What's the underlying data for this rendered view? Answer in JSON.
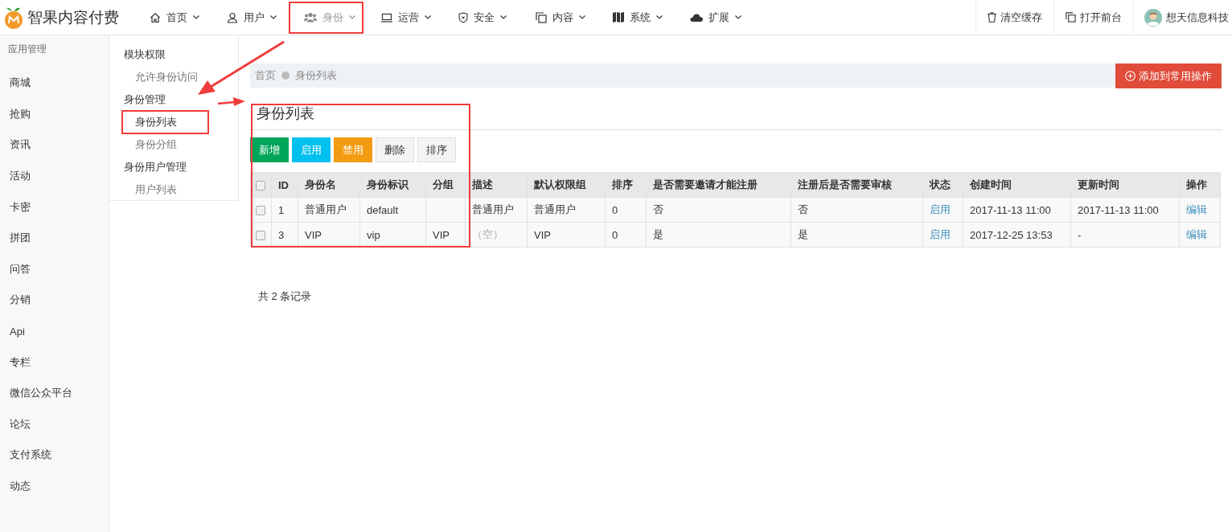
{
  "brand": {
    "title": "智果内容付费"
  },
  "nav": [
    {
      "label": "首页",
      "selected": false
    },
    {
      "label": "用户",
      "selected": false
    },
    {
      "label": "身份",
      "selected": true
    },
    {
      "label": "运营",
      "selected": false
    },
    {
      "label": "安全",
      "selected": false
    },
    {
      "label": "内容",
      "selected": false
    },
    {
      "label": "系统",
      "selected": false
    },
    {
      "label": "扩展",
      "selected": false
    }
  ],
  "top_actions": [
    "清空缓存",
    "打开前台"
  ],
  "user": {
    "name": "想天信息科技"
  },
  "sidebar": {
    "heading": "应用管理",
    "items": [
      "商城",
      "抢购",
      "资讯",
      "活动",
      "卡密",
      "拼团",
      "问答",
      "分销",
      "Api",
      "专栏",
      "微信公众平台",
      "论坛",
      "支付系统",
      "动态"
    ]
  },
  "submenu": [
    {
      "label": "模块权限",
      "children": [
        {
          "label": "允许身份访问",
          "selected": false
        }
      ]
    },
    {
      "label": "身份管理",
      "children": [
        {
          "label": "身份列表",
          "selected": true
        },
        {
          "label": "身份分组",
          "selected": false
        }
      ]
    },
    {
      "label": "身份用户管理",
      "children": [
        {
          "label": "用户列表",
          "selected": false
        }
      ]
    }
  ],
  "breadcrumb": [
    "首页",
    "身份列表"
  ],
  "add_shortcut": "添加到常用操作",
  "page_title": "身份列表",
  "toolbar": [
    {
      "label": "新增",
      "kind": "success"
    },
    {
      "label": "启用",
      "kind": "info"
    },
    {
      "label": "禁用",
      "kind": "warning"
    },
    {
      "label": "删除",
      "kind": "default"
    },
    {
      "label": "排序",
      "kind": "default"
    }
  ],
  "table": {
    "select_all_checked": false,
    "columns": [
      "ID",
      "身份名",
      "身份标识",
      "分组",
      "描述",
      "默认权限组",
      "排序",
      "是否需要邀请才能注册",
      "注册后是否需要审核",
      "状态",
      "创建时间",
      "更新时间",
      "操作"
    ],
    "rows": [
      {
        "checked": false,
        "cells": [
          {
            "text": "1",
            "kind": "text"
          },
          {
            "text": "普通用户",
            "kind": "text"
          },
          {
            "text": "default",
            "kind": "text"
          },
          {
            "text": "",
            "kind": "text"
          },
          {
            "text": "普通用户",
            "kind": "text"
          },
          {
            "text": "普通用户",
            "kind": "text"
          },
          {
            "text": "0",
            "kind": "text"
          },
          {
            "text": "否",
            "kind": "text"
          },
          {
            "text": "否",
            "kind": "text"
          },
          {
            "text": "启用",
            "kind": "link"
          },
          {
            "text": "2017-11-13 11:00",
            "kind": "text"
          },
          {
            "text": "2017-11-13 11:00",
            "kind": "text"
          },
          {
            "text": "编辑",
            "kind": "link"
          }
        ]
      },
      {
        "checked": false,
        "cells": [
          {
            "text": "3",
            "kind": "text"
          },
          {
            "text": "VIP",
            "kind": "text"
          },
          {
            "text": "vip",
            "kind": "text"
          },
          {
            "text": "VIP",
            "kind": "text"
          },
          {
            "text": "（空）",
            "kind": "empty"
          },
          {
            "text": "VIP",
            "kind": "text"
          },
          {
            "text": "0",
            "kind": "text"
          },
          {
            "text": "是",
            "kind": "text"
          },
          {
            "text": "是",
            "kind": "text"
          },
          {
            "text": "启用",
            "kind": "link"
          },
          {
            "text": "2017-12-25 13:53",
            "kind": "text"
          },
          {
            "text": "-",
            "kind": "text"
          },
          {
            "text": "编辑",
            "kind": "link"
          }
        ]
      }
    ]
  },
  "footer": "共 2 条记录"
}
